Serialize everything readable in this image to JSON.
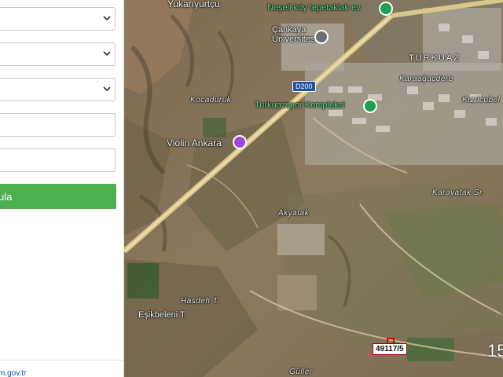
{
  "panel": {
    "query_button_label": "ula",
    "footer_link": "m.gov.tr"
  },
  "map": {
    "labels": {
      "yukariyurtcu": "Yukarıyurtçu",
      "neseli_koy": "Neşeli köy tepetaklak ev",
      "cankaya_uni_1": "Çankaya",
      "cankaya_uni_2": "Üniversitesi",
      "turkuaz": "TURKUAZ",
      "karaagacdere": "Karaağaçdere",
      "kizilcubel": "Kızılcubel",
      "turkuazspor": "Turkuazspor Kompleksi",
      "kocaduruk": "Kocaduruk",
      "violin": "Violin Ankara",
      "karayatak": "Karayatak Sr.",
      "akyatak": "Akyatak",
      "hasdeh": "Hasdeh T.",
      "esikbeleni": "Eşikbeleni T.",
      "guller": "Güller"
    },
    "road_shield": "D200",
    "parcel_label": "49117/5",
    "zoom_readout": "15"
  },
  "colors": {
    "accent_green": "#4caf50",
    "poi_green": "#1e9e57",
    "poi_purple": "#9c4ad6",
    "parcel_red": "#d60000",
    "road_shield_blue": "#1f4f9e"
  }
}
